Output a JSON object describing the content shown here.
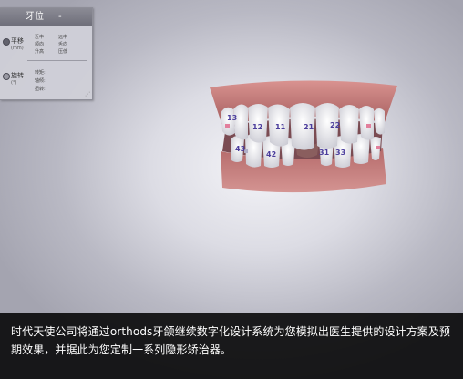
{
  "panel": {
    "title": "牙位",
    "collapse": "-",
    "translation": {
      "label": "平移",
      "unit": "(mm)",
      "col1": [
        "近中",
        "颊向",
        "升高"
      ],
      "col2": [
        "远中",
        "舌向",
        "压低"
      ]
    },
    "rotation": {
      "label": "旋转",
      "unit": "(°)",
      "items": [
        "转矩:",
        "轴倾:",
        "扭转:"
      ]
    }
  },
  "model": {
    "upper_teeth": [
      "13",
      "12",
      "11",
      "21",
      "22"
    ],
    "lower_teeth": [
      "43",
      "42",
      "31",
      "33"
    ],
    "colors": {
      "gingiva": "#cf8a88",
      "tooth": "#f4f4f6",
      "attachment": "#e27f9c"
    }
  },
  "caption": {
    "text": "时代天使公司将通过orthods牙颌继续数字化设计系统为您模拟出医生提供的设计方案及预期效果，并据此为您定制一系列隐形矫治器。"
  }
}
